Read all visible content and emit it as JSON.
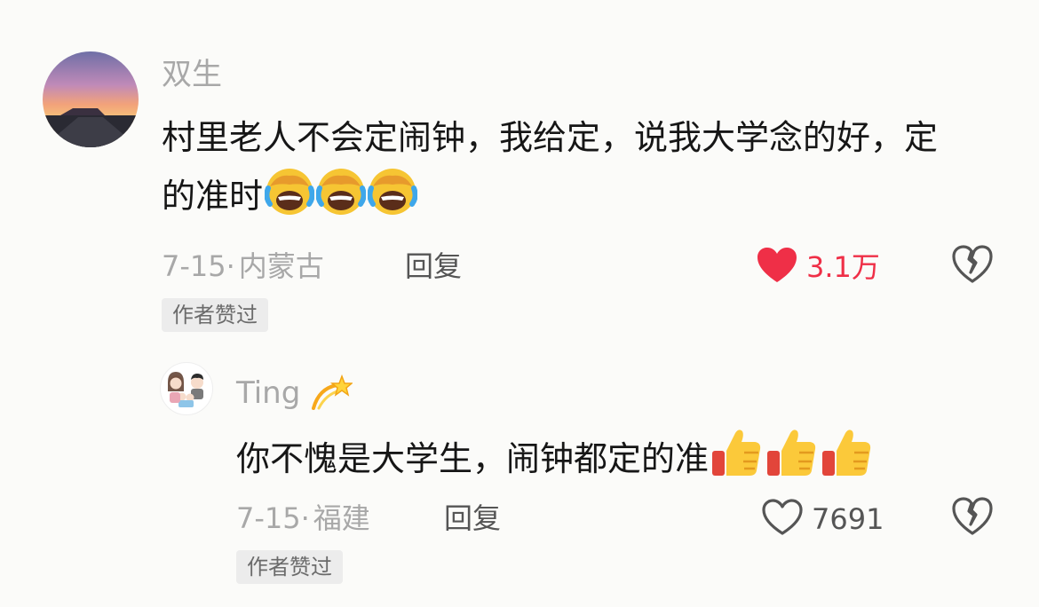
{
  "comments": [
    {
      "username": "双生",
      "text": "村里老人不会定闹钟，我给定，说我大学念的好，定的准时",
      "emoji_name": "laughing-crying-emoji",
      "emoji_count": 3,
      "date": "7-15·",
      "location": "内蒙古",
      "reply_label": "回复",
      "like_count": "3.1万",
      "liked": true,
      "badge": "作者赞过"
    },
    {
      "username": "Ting",
      "username_emoji": "dizzy-emoji",
      "text": "你不愧是大学生，闹钟都定的准",
      "emoji_name": "thumbs-up-emoji",
      "emoji_count": 3,
      "date": "7-15·",
      "location": "福建",
      "reply_label": "回复",
      "like_count": "7691",
      "liked": false,
      "badge": "作者赞过"
    }
  ],
  "colors": {
    "like_active": "#ef2f47",
    "meta_gray": "#a8a8a8",
    "badge_bg": "#ececec"
  }
}
